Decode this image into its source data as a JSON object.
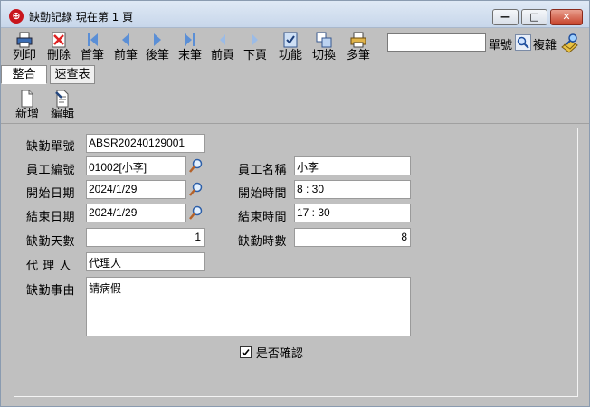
{
  "window": {
    "title": "缺勤記錄 現在第 1 頁",
    "app_icon_glyph": "⊕",
    "min_glyph": "—",
    "max_glyph": "□",
    "close_glyph": "✕"
  },
  "toolbar": {
    "print": "列印",
    "delete": "刪除",
    "first": "首筆",
    "prev": "前筆",
    "next": "後筆",
    "last": "末筆",
    "prev_page": "前頁",
    "next_page": "下頁",
    "function": "功能",
    "switch": "切換",
    "multi": "多筆",
    "search_value": "",
    "search_label": "單號",
    "complex_label": "複雜"
  },
  "tabs": [
    {
      "label": "整合"
    },
    {
      "label": "速查表"
    }
  ],
  "subtoolbar": {
    "add": "新增",
    "edit": "編輯"
  },
  "form": {
    "absence_no_label": "缺勤單號",
    "absence_no": "ABSR20240129001",
    "employee_no_label": "員工編號",
    "employee_no": "01002[小李]",
    "employee_name_label": "員工名稱",
    "employee_name": "小李",
    "start_date_label": "開始日期",
    "start_date": "2024/1/29",
    "start_time_label": "開始時間",
    "start_time": "8 : 30",
    "end_date_label": "結束日期",
    "end_date": "2024/1/29",
    "end_time_label": "結束時間",
    "end_time": "17 : 30",
    "days_label": "缺勤天數",
    "days": "1",
    "hours_label": "缺勤時數",
    "hours": "8",
    "agent_label": "代 理 人",
    "agent": "代理人",
    "reason_label": "缺勤事由",
    "reason": "請病假",
    "confirmed_label": "是否確認",
    "confirmed": true
  },
  "colors": {
    "window_bg": "#c0c0c0",
    "title_gradient_top": "#dfe9f5",
    "close_red": "#c7432b",
    "nav_icon_blue": "#5b8fd6"
  },
  "icons": {
    "print": "printer-icon",
    "delete": "delete-icon",
    "first": "first-record-icon",
    "prev": "prev-record-icon",
    "next": "next-record-icon",
    "last": "last-record-icon",
    "prev_page": "prev-page-icon",
    "next_page": "next-page-icon",
    "function": "function-icon",
    "switch": "switch-view-icon",
    "multi": "multi-record-icon",
    "search": "magnifier-icon",
    "complex": "complex-search-icon",
    "add": "new-document-icon",
    "edit": "edit-document-icon",
    "lookup": "lookup-icon"
  }
}
